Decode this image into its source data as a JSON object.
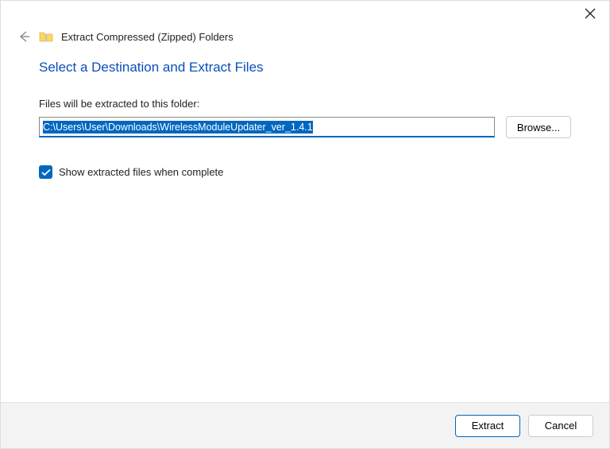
{
  "titlebar": {
    "close_label": "Close"
  },
  "header": {
    "dialog_title": "Extract Compressed (Zipped) Folders"
  },
  "content": {
    "heading": "Select a Destination and Extract Files",
    "folder_label": "Files will be extracted to this folder:",
    "path_value": "C:\\Users\\User\\Downloads\\WirelessModuleUpdater_ver_1.4.1",
    "browse_label": "Browse...",
    "checkbox_label": "Show extracted files when complete",
    "checkbox_checked": true
  },
  "footer": {
    "extract_label": "Extract",
    "cancel_label": "Cancel"
  }
}
